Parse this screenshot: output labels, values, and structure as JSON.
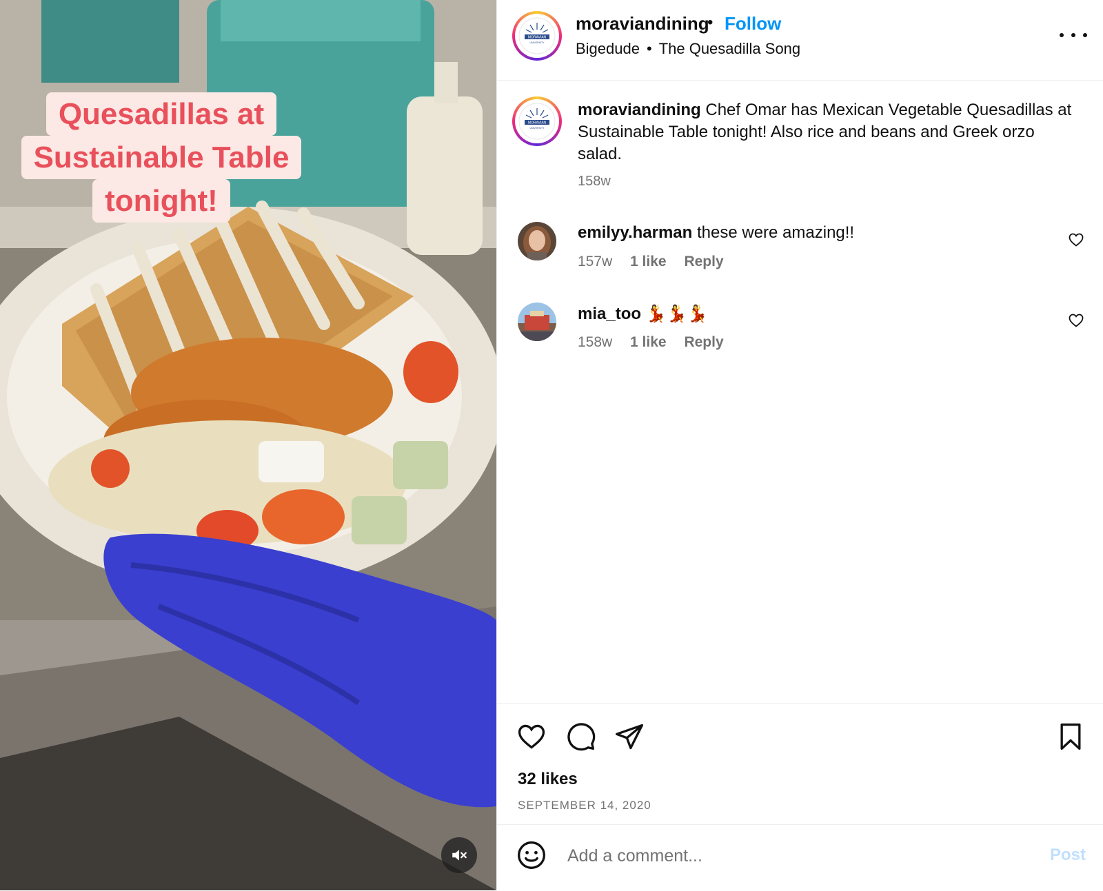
{
  "media": {
    "overlay_lines": [
      "Quesadillas at",
      "Sustainable Table",
      "tonight!"
    ],
    "mute_icon": "speaker-muted-icon"
  },
  "header": {
    "username": "moraviandining",
    "dot": "•",
    "follow_label": "Follow",
    "audio_artist": "Bigedude",
    "audio_sep": "•",
    "audio_title": "The Quesadilla Song",
    "more_icon": "more-options-icon"
  },
  "caption": {
    "username": "moraviandining",
    "text": "Chef Omar has Mexican Vegetable Quesadillas at Sustainable Table tonight! Also rice and beans and Greek orzo salad.",
    "time": "158w"
  },
  "comments": [
    {
      "username": "emilyy.harman",
      "text": "these were amazing!!",
      "time": "157w",
      "likes": "1 like",
      "reply": "Reply"
    },
    {
      "username": "mia_too",
      "text": "💃💃💃",
      "time": "158w",
      "likes": "1 like",
      "reply": "Reply"
    }
  ],
  "actions": {
    "like_icon": "heart-icon",
    "comment_icon": "comment-icon",
    "share_icon": "share-icon",
    "save_icon": "bookmark-icon",
    "likes": "32 likes",
    "date": "SEPTEMBER 14, 2020"
  },
  "add_comment": {
    "placeholder": "Add a comment...",
    "post_label": "Post",
    "emoji_icon": "emoji-icon"
  },
  "colors": {
    "accent": "#0095f6",
    "post_disabled": "#c0dffd",
    "overlay_text": "#e8505b",
    "overlay_bg": "#fce8e4",
    "glove": "#3a3fd0"
  }
}
